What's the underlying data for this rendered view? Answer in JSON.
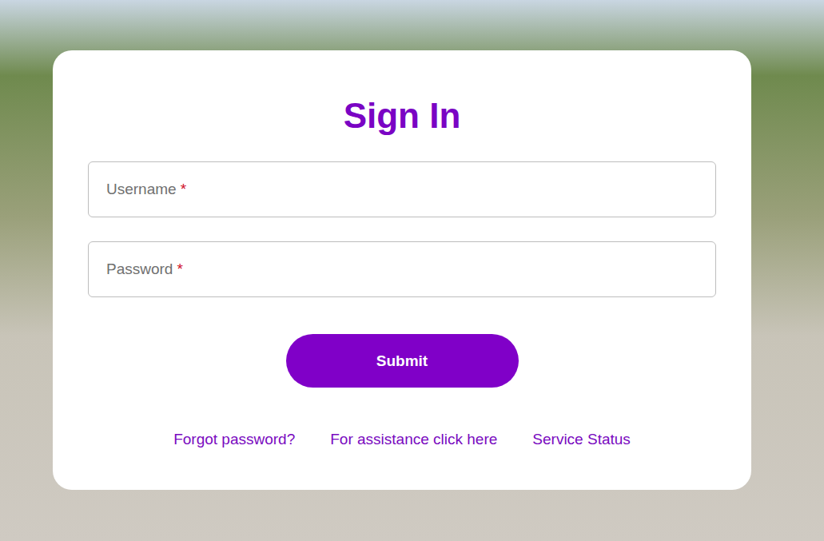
{
  "title": "Sign In",
  "fields": [
    {
      "label": "Username",
      "required_mark": "*"
    },
    {
      "label": "Password",
      "required_mark": "*"
    }
  ],
  "submit": {
    "label": "Submit"
  },
  "links": [
    "Forgot password?",
    "For assistance click here",
    "Service Status"
  ]
}
